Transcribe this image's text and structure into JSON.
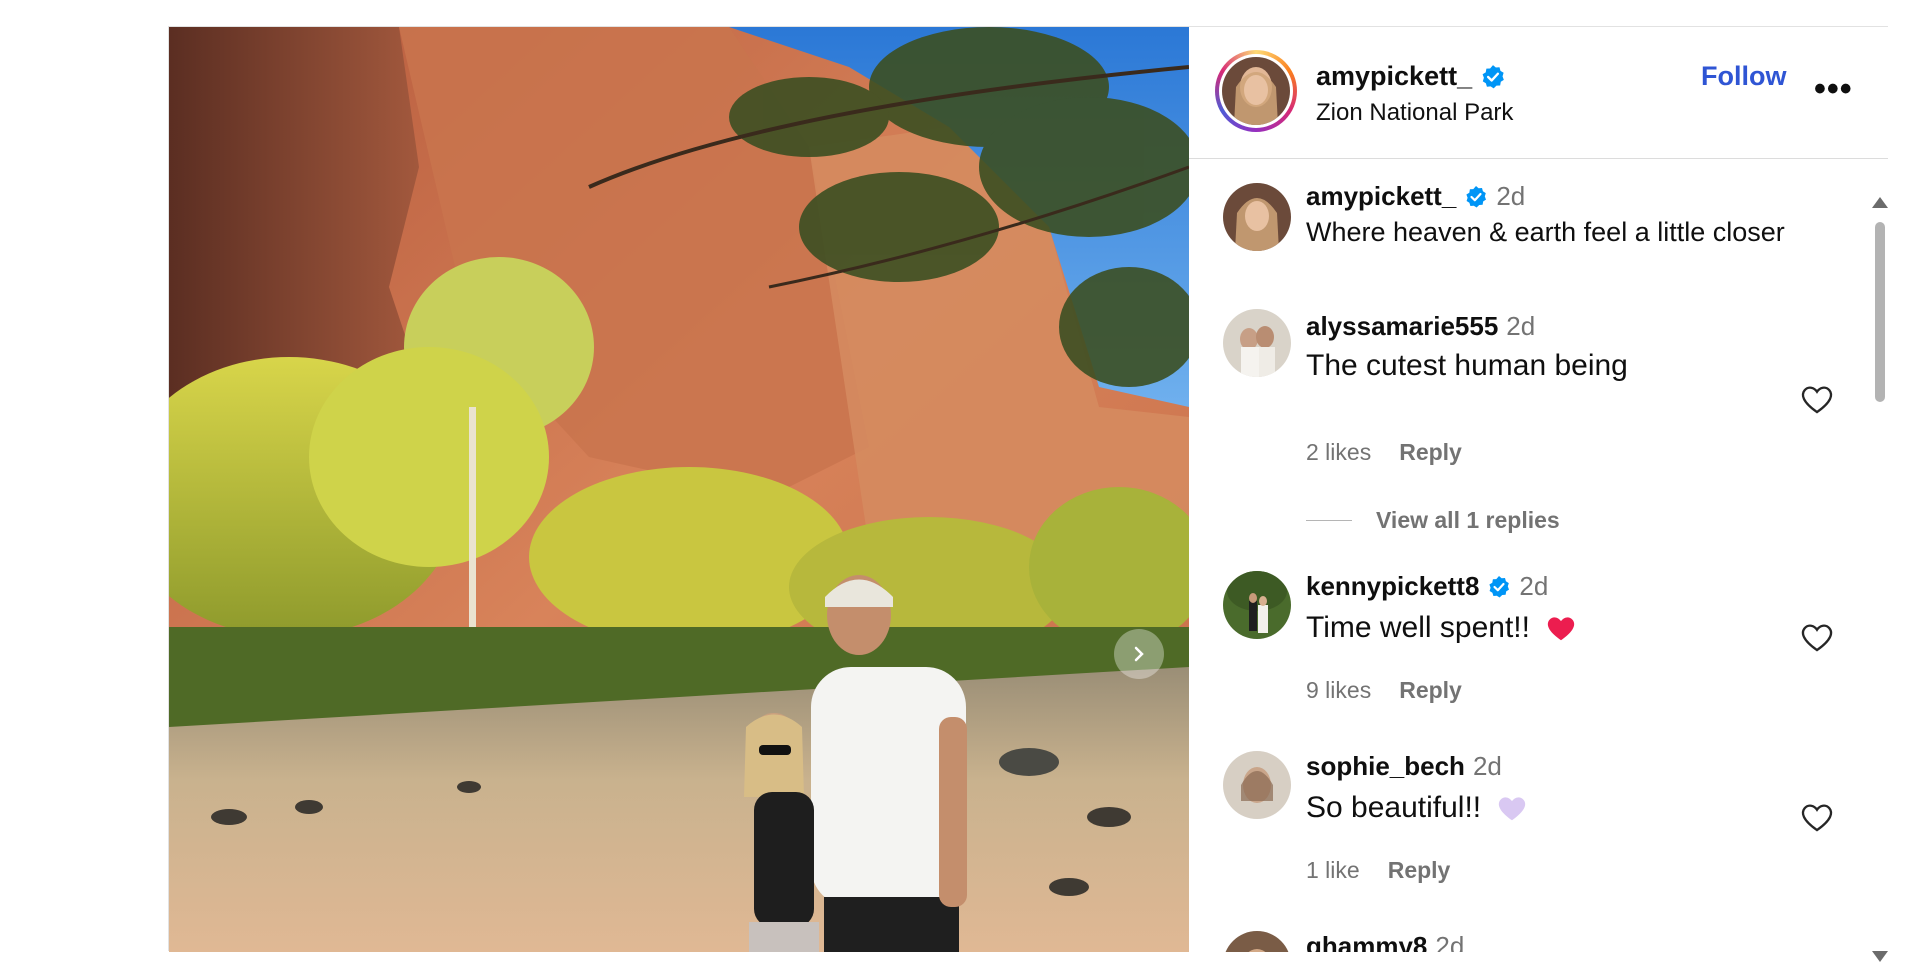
{
  "post": {
    "author": {
      "username": "amypickett_",
      "verified": true,
      "location": "Zion National Park"
    },
    "follow_label": "Follow",
    "more_label": "•••",
    "photo_alt": "Couple standing by a river in a red canyon with yellow trees",
    "next_icon": "chevron-right-icon",
    "colors": {
      "follow": "#2f55d4",
      "verified_badge": "#0095f6",
      "muted": "#737373"
    }
  },
  "comments": [
    {
      "username": "amypickett_",
      "verified": true,
      "time": "2d",
      "text": "Where heaven & earth feel a little closer"
    },
    {
      "username": "alyssamarie555",
      "verified": false,
      "time": "2d",
      "text": "The cutest human being",
      "likes": "2 likes",
      "reply": "Reply",
      "view_replies": "View all 1 replies"
    },
    {
      "username": "kennypickett8",
      "verified": true,
      "time": "2d",
      "text": "Time well spent!!",
      "emoji": "red-heart-emoji",
      "likes": "9 likes",
      "reply": "Reply"
    },
    {
      "username": "sophie_bech",
      "verified": false,
      "time": "2d",
      "text": "So beautiful!!",
      "emoji": "purple-heart-emoji",
      "likes": "1 like",
      "reply": "Reply"
    },
    {
      "username": "ghammy8",
      "verified": false,
      "time": "2d"
    }
  ]
}
